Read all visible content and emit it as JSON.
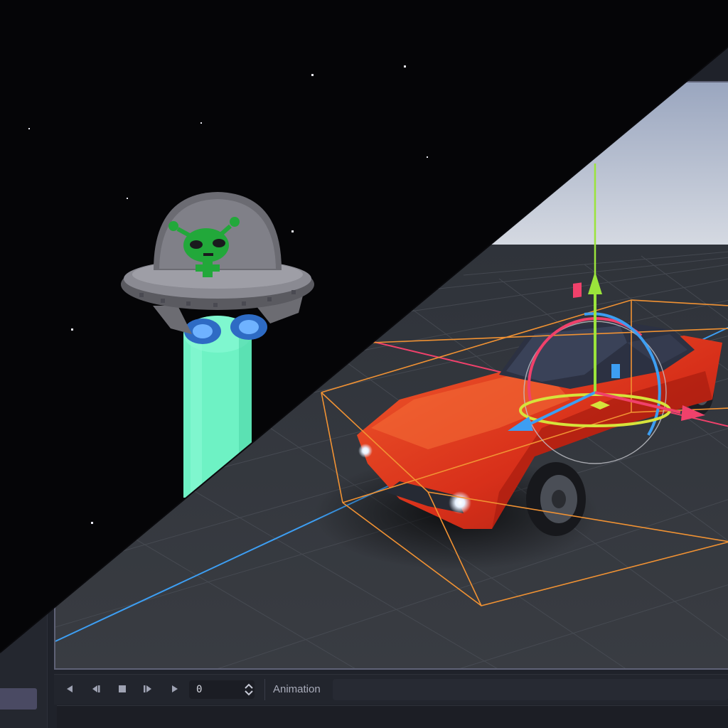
{
  "animation_bar": {
    "frame_value": "0",
    "label": "Animation"
  },
  "icons": {
    "jump_back": "jump-to-start-icon",
    "step_back": "play-backwards-icon",
    "stop": "stop-icon",
    "step_forward": "play-from-start-icon",
    "play": "play-icon",
    "spin": "spin-arrows-icon"
  },
  "colors": {
    "gizmo_y": "#9be43b",
    "gizmo_x": "#f0416b",
    "gizmo_z": "#3d9ef2",
    "selection_box": "#f19233",
    "car_body": "#e5391a",
    "beam": "#6ef2c4",
    "alien": "#22a83a"
  }
}
